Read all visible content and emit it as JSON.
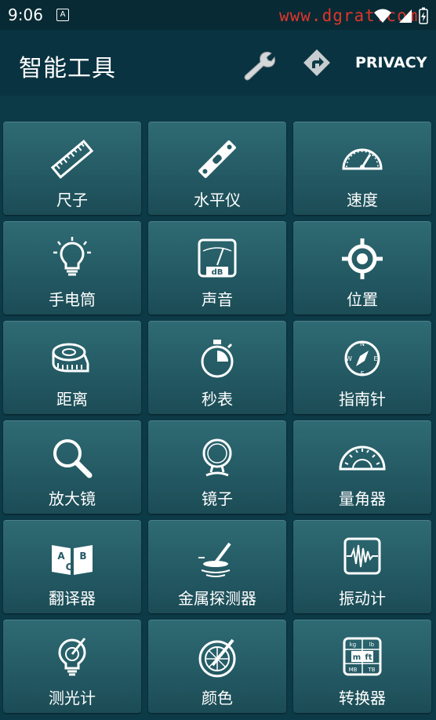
{
  "status": {
    "time": "9:06",
    "notif_letter": "A",
    "watermark": "www.dgrat.com"
  },
  "app_bar": {
    "title": "智能工具",
    "privacy_label": "PRIVACY",
    "wrench_icon": "wrench-icon",
    "share_icon": "share-icon"
  },
  "tiles": [
    {
      "label": "尺子",
      "icon": "ruler-icon"
    },
    {
      "label": "水平仪",
      "icon": "level-icon"
    },
    {
      "label": "速度",
      "icon": "speedometer-icon"
    },
    {
      "label": "手电筒",
      "icon": "flashlight-bulb-icon"
    },
    {
      "label": "声音",
      "icon": "decibel-meter-icon"
    },
    {
      "label": "位置",
      "icon": "location-target-icon"
    },
    {
      "label": "距离",
      "icon": "tape-measure-icon"
    },
    {
      "label": "秒表",
      "icon": "stopwatch-icon"
    },
    {
      "label": "指南针",
      "icon": "compass-icon"
    },
    {
      "label": "放大镜",
      "icon": "magnifier-icon"
    },
    {
      "label": "镜子",
      "icon": "mirror-icon"
    },
    {
      "label": "量角器",
      "icon": "protractor-icon"
    },
    {
      "label": "翻译器",
      "icon": "translator-book-icon"
    },
    {
      "label": "金属探测器",
      "icon": "metal-detector-icon"
    },
    {
      "label": "振动计",
      "icon": "vibration-meter-icon"
    },
    {
      "label": "测光计",
      "icon": "light-meter-icon"
    },
    {
      "label": "颜色",
      "icon": "color-wheel-icon"
    },
    {
      "label": "转换器",
      "icon": "unit-converter-icon"
    }
  ],
  "converter_units": [
    "kg",
    "lb",
    "m",
    "ft",
    "MB",
    "TB"
  ],
  "decibel_unit": "dB",
  "translator_letters": [
    "A",
    "B",
    "C"
  ]
}
